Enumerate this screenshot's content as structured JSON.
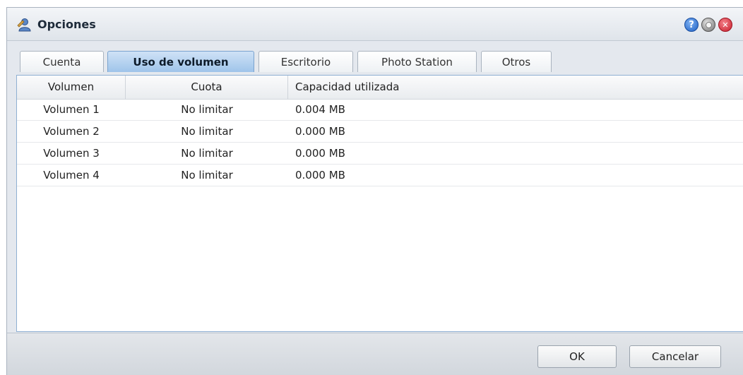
{
  "window": {
    "title": "Opciones",
    "controls": {
      "help": "?",
      "minimize": "",
      "close": "✕"
    }
  },
  "tabs": [
    {
      "label": "Cuenta",
      "active": false
    },
    {
      "label": "Uso de volumen",
      "active": true
    },
    {
      "label": "Escritorio",
      "active": false
    },
    {
      "label": "Photo Station",
      "active": false
    },
    {
      "label": "Otros",
      "active": false
    }
  ],
  "table": {
    "columns": [
      "Volumen",
      "Cuota",
      "Capacidad utilizada"
    ],
    "rows": [
      [
        "Volumen 1",
        "No limitar",
        "0.004 MB"
      ],
      [
        "Volumen 2",
        "No limitar",
        "0.000 MB"
      ],
      [
        "Volumen 3",
        "No limitar",
        "0.000 MB"
      ],
      [
        "Volumen 4",
        "No limitar",
        "0.000 MB"
      ]
    ]
  },
  "buttons": {
    "ok": "OK",
    "cancel": "Cancelar"
  },
  "colors": {
    "active_tab": "#9fc4ea",
    "panel_border": "#8fb0d2",
    "close": "#c81e2c",
    "help": "#1d5fc4"
  },
  "icons": {
    "app": "user-options-icon",
    "help": "help-icon",
    "minimize": "minimize-icon",
    "close": "close-icon"
  }
}
